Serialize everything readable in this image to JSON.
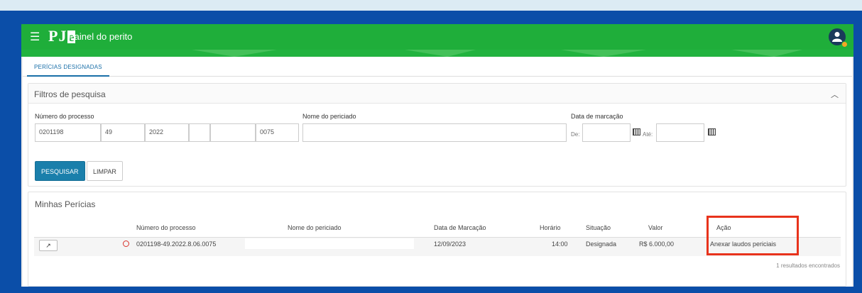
{
  "header": {
    "logo_text": "PJ",
    "logo_e": "e",
    "title": "Painel do perito",
    "menu_icon": "hamburger-icon",
    "avatar_icon": "user-icon"
  },
  "tabs": [
    {
      "label": "PERÍCIAS DESIGNADAS",
      "active": true
    }
  ],
  "filters": {
    "title": "Filtros de pesquisa",
    "numero_label": "Número do processo",
    "numero_parts": [
      "0201198",
      "49",
      "2022",
      "",
      "",
      "0075"
    ],
    "nome_label": "Nome do periciado",
    "nome_value": "",
    "data_label": "Data de marcação",
    "de_label": "De:",
    "ate_label": "Até:",
    "de_value": "",
    "ate_value": "",
    "search_label": "PESQUISAR",
    "clear_label": "LIMPAR"
  },
  "results": {
    "title": "Minhas Perícias",
    "columns": [
      "Número do processo",
      "Nome do periciado",
      "Data de Marcação",
      "Horário",
      "Situação",
      "Valor",
      "Ação"
    ],
    "rows": [
      {
        "numero": "0201198-49.2022.8.06.0075",
        "nome": "",
        "data": "12/09/2023",
        "horario": "14:00",
        "situacao": "Designada",
        "valor": "R$ 6.000,00",
        "acao": "Anexar laudos periciais"
      }
    ],
    "count": "1 resultados encontrados"
  },
  "colors": {
    "navbar": "#1fae3a",
    "primary_button": "#1a7fab",
    "highlight": "#e8331c",
    "alert": "#d9322b",
    "frame": "#0b4ea8"
  }
}
